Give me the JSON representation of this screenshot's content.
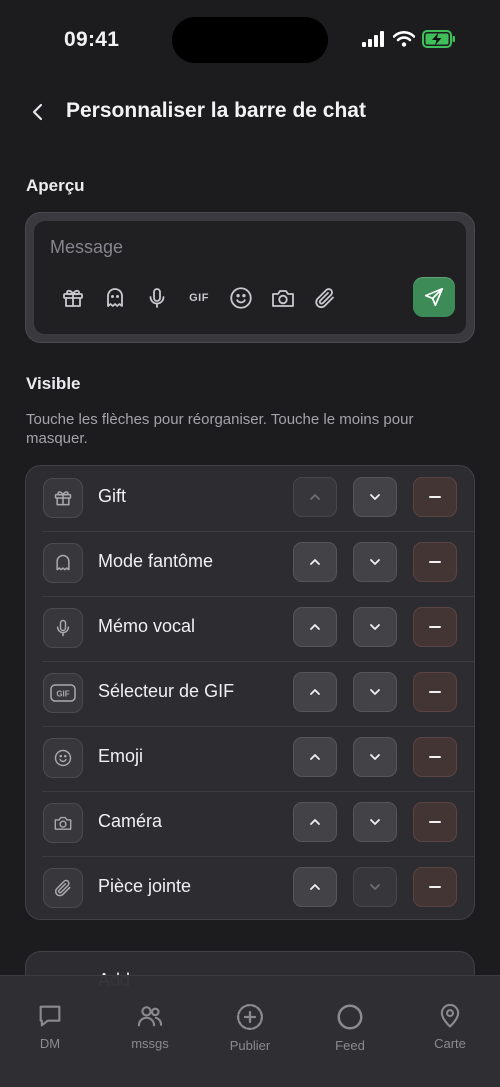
{
  "status_bar": {
    "time": "09:41"
  },
  "header": {
    "title": "Personnaliser la barre de chat"
  },
  "preview": {
    "label": "Aperçu",
    "placeholder": "Message",
    "tools": [
      "gift-icon",
      "ghost-icon",
      "mic-icon",
      "gif-icon",
      "emoji-icon",
      "camera-icon",
      "paperclip-icon"
    ],
    "gif_text": "GIF",
    "send_color": "#3d8c57"
  },
  "visible": {
    "label": "Visible",
    "hint": "Touche les flèches pour réorganiser. Touche le moins pour masquer.",
    "items": [
      {
        "label": "Gift",
        "icon": "gift-icon",
        "up_enabled": false,
        "down_enabled": true
      },
      {
        "label": "Mode fantôme",
        "icon": "ghost-icon",
        "up_enabled": true,
        "down_enabled": true
      },
      {
        "label": "Mémo vocal",
        "icon": "mic-icon",
        "up_enabled": true,
        "down_enabled": true
      },
      {
        "label": "Sélecteur de GIF",
        "icon": "gif-icon",
        "up_enabled": true,
        "down_enabled": true
      },
      {
        "label": "Emoji",
        "icon": "emoji-icon",
        "up_enabled": true,
        "down_enabled": true
      },
      {
        "label": "Caméra",
        "icon": "camera-icon",
        "up_enabled": true,
        "down_enabled": true
      },
      {
        "label": "Pièce jointe",
        "icon": "paperclip-icon",
        "up_enabled": true,
        "down_enabled": false
      }
    ]
  },
  "hidden_section": {
    "label": "Add"
  },
  "tabbar": {
    "items": [
      {
        "label": "DM",
        "icon": "chat-bubble-icon"
      },
      {
        "label": "mssgs",
        "icon": "people-icon"
      },
      {
        "label": "Publier",
        "icon": "plus-circle-icon"
      },
      {
        "label": "Feed",
        "icon": "circle-icon"
      },
      {
        "label": "Carte",
        "icon": "map-pin-icon"
      }
    ]
  }
}
